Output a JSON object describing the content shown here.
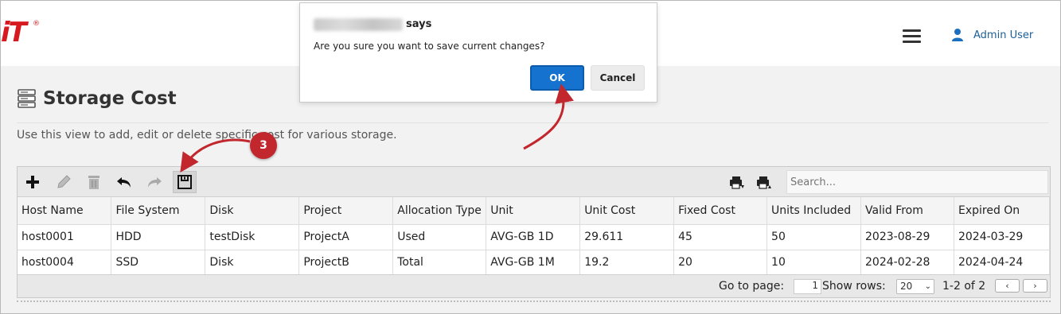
{
  "header": {
    "logo_text": "iT",
    "logo_mark": "®",
    "menu_icon": "hamburger-icon",
    "user_icon": "user-icon",
    "user_name": "Admin User"
  },
  "page": {
    "title": "Storage Cost",
    "title_icon": "storage-server-icon",
    "description": "Use this view to add, edit or delete specific cost for various storage."
  },
  "toolbar": {
    "icons": [
      "add-icon",
      "edit-icon",
      "delete-icon",
      "undo-icon",
      "redo-icon",
      "save-icon",
      "export-icon",
      "import-icon"
    ],
    "search_placeholder": "Search..."
  },
  "table": {
    "columns": [
      "Host Name",
      "File System",
      "Disk",
      "Project",
      "Allocation Type",
      "Unit",
      "Unit Cost",
      "Fixed Cost",
      "Units Included",
      "Valid From",
      "Expired On"
    ],
    "rows": [
      [
        "host0001",
        "HDD",
        "testDisk",
        "ProjectA",
        "Used",
        "AVG-GB 1D",
        "29.611",
        "45",
        "50",
        "2023-08-29",
        "2024-03-29"
      ],
      [
        "host0004",
        "SSD",
        "Disk",
        "ProjectB",
        "Total",
        "AVG-GB 1M",
        "19.2",
        "20",
        "10",
        "2024-02-28",
        "2024-04-24"
      ]
    ]
  },
  "pager": {
    "goto_label": "Go to page:",
    "page_value": "1",
    "show_rows_label": "Show rows:",
    "rows_value": "20",
    "range_text": "1-2 of 2",
    "prev": "‹",
    "next": "›"
  },
  "dialog": {
    "says": "says",
    "message": "Are you sure you want to save current changes?",
    "ok_label": "OK",
    "cancel_label": "Cancel"
  },
  "annotation": {
    "step_number": "3",
    "accent_color": "#c1272d"
  }
}
